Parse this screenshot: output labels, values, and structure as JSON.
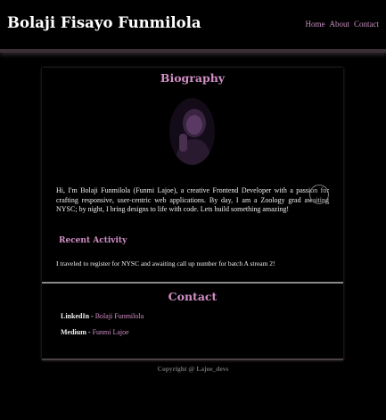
{
  "header": {
    "site_title": "Bolaji Fisayo Funmilola",
    "nav": [
      {
        "label": "Home"
      },
      {
        "label": "About"
      },
      {
        "label": "Contact"
      }
    ]
  },
  "biography": {
    "title": "Biography",
    "avatar_icon": "profile-photo",
    "text": "Hi, I'm Bolaji Funmilola (Funmi Lajoe), a creative Frontend Developer with a passion for crafting responsive, user-centric web applications. By day, I am a Zoology grad awaiting NYSC; by night, I bring designs to life with code. Lets build something amazing!",
    "recent_activity_title": "Recent Activity",
    "recent_activity_text": "I traveled to register for NYSC and awaiting call up number for batch A stream 2!"
  },
  "contact": {
    "title": "Contact",
    "linkedin_label": "LinkedIn",
    "linkedin_value": "Bolaji Funmilola",
    "medium_label": "Medium",
    "medium_value": "Funmi Lajoe",
    "separator": " - "
  },
  "footer": {
    "prefix": "Copyright @ ",
    "handle": "Lajoe_devs"
  },
  "colors": {
    "accent": "#d18ec6",
    "background": "#000000",
    "text": "#f0f0f0"
  }
}
